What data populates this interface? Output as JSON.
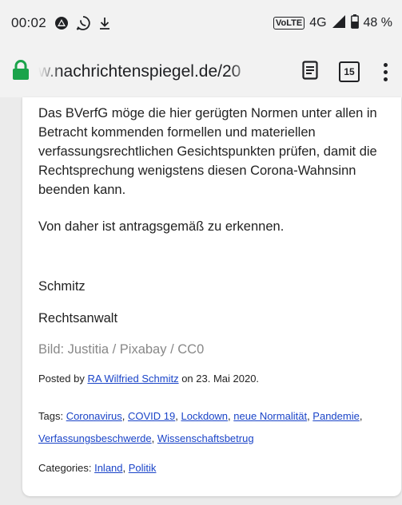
{
  "status_bar": {
    "time": "00:02",
    "network_label": "4G",
    "volte_label": "VoLTE",
    "battery": "48 %"
  },
  "browser": {
    "url": "w.nachrichtenspiegel.de/20",
    "tab_count": "15"
  },
  "article": {
    "paragraph1": "Das BVerfG möge die hier gerügten Normen unter allen in Betracht kommenden formellen und materiellen verfassungsrechtlichen Gesichtspunkten prüfen, damit die Rechtsprechung wenigstens diesen Corona-Wahnsinn beenden kann.",
    "paragraph2": "Von daher ist antragsgemäß zu erkennen.",
    "signature_name": "Schmitz",
    "signature_title": "Rechtsanwalt",
    "image_credit": "Bild: Justitia / Pixabay / CC0"
  },
  "meta": {
    "posted_by_prefix": "Posted by ",
    "author": "RA Wilfried Schmitz",
    "posted_on": " on 23. Mai 2020.",
    "tags_label": "Tags: ",
    "tags": [
      "Coronavirus",
      "COVID 19",
      "Lockdown",
      "neue Normalität",
      "Pandemie",
      "Verfassungsbeschwerde",
      "Wissenschaftsbetrug"
    ],
    "categories_label": "Categories: ",
    "categories": [
      "Inland",
      "Politik"
    ]
  },
  "colors": {
    "lock": "#1aa34a",
    "link": "#1a44c8"
  }
}
